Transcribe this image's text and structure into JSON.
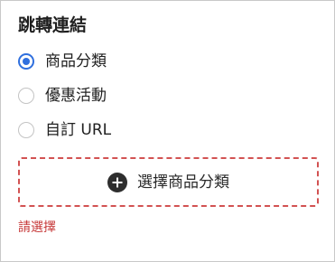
{
  "section": {
    "title": "跳轉連結"
  },
  "link_type": {
    "options": [
      {
        "label": "商品分類",
        "selected": true
      },
      {
        "label": "優惠活動",
        "selected": false
      },
      {
        "label": "自訂 URL",
        "selected": false
      }
    ]
  },
  "picker": {
    "icon": "plus-circle-icon",
    "label": "選擇商品分類"
  },
  "validation": {
    "message": "請選擇"
  },
  "colors": {
    "accent": "#2f6fde",
    "error": "#c73a3a",
    "dashed_border": "#d25252"
  }
}
